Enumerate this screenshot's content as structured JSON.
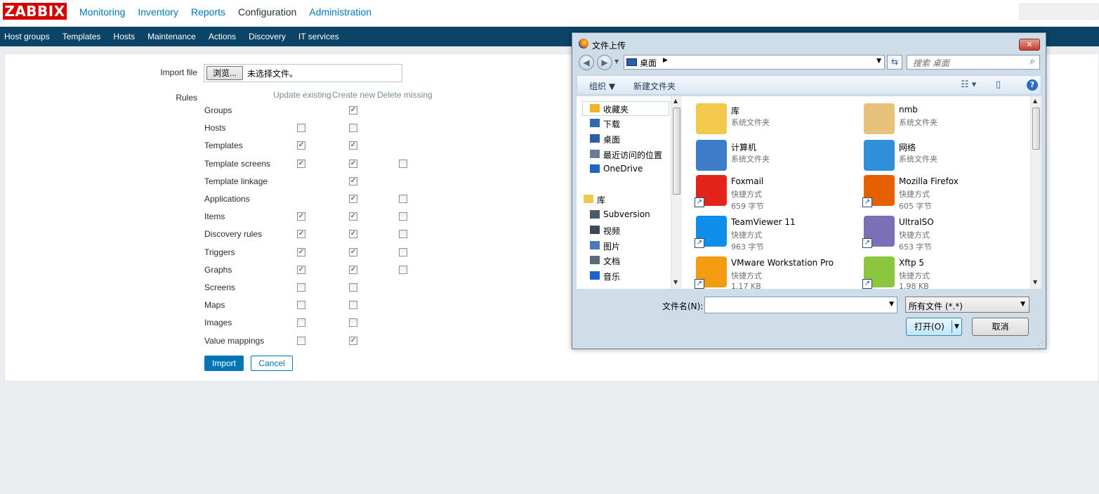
{
  "app": {
    "logo": "ZABBIX"
  },
  "main_menu": [
    "Monitoring",
    "Inventory",
    "Reports",
    "Configuration",
    "Administration"
  ],
  "main_menu_active": "Configuration",
  "sub_menu": [
    "Host groups",
    "Templates",
    "Hosts",
    "Maintenance",
    "Actions",
    "Discovery",
    "IT services"
  ],
  "form": {
    "import_file_label": "Import file",
    "browse_label": "浏览...",
    "no_file_text": "未选择文件。",
    "rules_label": "Rules",
    "col_update": "Update existing",
    "col_create": "Create new",
    "col_delete": "Delete missing",
    "import_button": "Import",
    "cancel_button": "Cancel",
    "rules": [
      {
        "name": "Groups",
        "update": null,
        "create": true,
        "delete": null
      },
      {
        "name": "Hosts",
        "update": false,
        "create": false,
        "delete": null
      },
      {
        "name": "Templates",
        "update": true,
        "create": true,
        "delete": null
      },
      {
        "name": "Template screens",
        "update": true,
        "create": true,
        "delete": false
      },
      {
        "name": "Template linkage",
        "update": null,
        "create": true,
        "delete": null
      },
      {
        "name": "Applications",
        "update": null,
        "create": true,
        "delete": false
      },
      {
        "name": "Items",
        "update": true,
        "create": true,
        "delete": false
      },
      {
        "name": "Discovery rules",
        "update": true,
        "create": true,
        "delete": false
      },
      {
        "name": "Triggers",
        "update": true,
        "create": true,
        "delete": false
      },
      {
        "name": "Graphs",
        "update": true,
        "create": true,
        "delete": false
      },
      {
        "name": "Screens",
        "update": false,
        "create": false,
        "delete": null
      },
      {
        "name": "Maps",
        "update": false,
        "create": false,
        "delete": null
      },
      {
        "name": "Images",
        "update": false,
        "create": false,
        "delete": null
      },
      {
        "name": "Value mappings",
        "update": false,
        "create": true,
        "delete": null
      }
    ]
  },
  "dialog": {
    "title": "文件上传",
    "address": "桌面",
    "search_placeholder": "搜索 桌面",
    "toolbar_organize": "组织 ▼",
    "toolbar_new_folder": "新建文件夹",
    "nav": [
      {
        "label": "收藏夹",
        "icon": "star-icon"
      },
      {
        "label": "下载",
        "icon": "download-icon"
      },
      {
        "label": "桌面",
        "icon": "desktop-icon"
      },
      {
        "label": "最近访问的位置",
        "icon": "recent-icon"
      },
      {
        "label": "OneDrive",
        "icon": "cloud-icon"
      },
      {
        "label": "库",
        "icon": "library-icon"
      },
      {
        "label": "Subversion",
        "icon": "svn-icon"
      },
      {
        "label": "视频",
        "icon": "video-icon"
      },
      {
        "label": "图片",
        "icon": "picture-icon"
      },
      {
        "label": "文档",
        "icon": "document-icon"
      },
      {
        "label": "音乐",
        "icon": "music-icon"
      }
    ],
    "files": [
      {
        "name": "库",
        "line2": "系统文件夹",
        "line3": "",
        "icon": "library-folder-icon",
        "color": "#f2c94c"
      },
      {
        "name": "nmb",
        "line2": "系统文件夹",
        "line3": "",
        "icon": "user-folder-icon",
        "color": "#e7c27a"
      },
      {
        "name": "计算机",
        "line2": "系统文件夹",
        "line3": "",
        "icon": "computer-icon",
        "color": "#3d7cc9"
      },
      {
        "name": "网络",
        "line2": "系统文件夹",
        "line3": "",
        "icon": "network-icon",
        "color": "#2f8fd8"
      },
      {
        "name": "Foxmail",
        "line2": "快捷方式",
        "line3": "659 字节",
        "icon": "foxmail-icon",
        "color": "#e3241b"
      },
      {
        "name": "Mozilla Firefox",
        "line2": "快捷方式",
        "line3": "605 字节",
        "icon": "firefox-icon",
        "color": "#e66000"
      },
      {
        "name": "TeamViewer 11",
        "line2": "快捷方式",
        "line3": "963 字节",
        "icon": "teamviewer-icon",
        "color": "#0e8ee9"
      },
      {
        "name": "UltraISO",
        "line2": "快捷方式",
        "line3": "653 字节",
        "icon": "ultraiso-icon",
        "color": "#7b6fb5"
      },
      {
        "name": "VMware Workstation Pro",
        "line2": "快捷方式",
        "line3": "1.17 KB",
        "icon": "vmware-icon",
        "color": "#f39c12"
      },
      {
        "name": "Xftp 5",
        "line2": "快捷方式",
        "line3": "1.98 KB",
        "icon": "xftp-icon",
        "color": "#8cc63f"
      }
    ],
    "filename_label": "文件名(N):",
    "filename_value": "",
    "filetype_value": "所有文件 (*.*)",
    "open_button": "打开(O)",
    "cancel_button": "取消"
  }
}
